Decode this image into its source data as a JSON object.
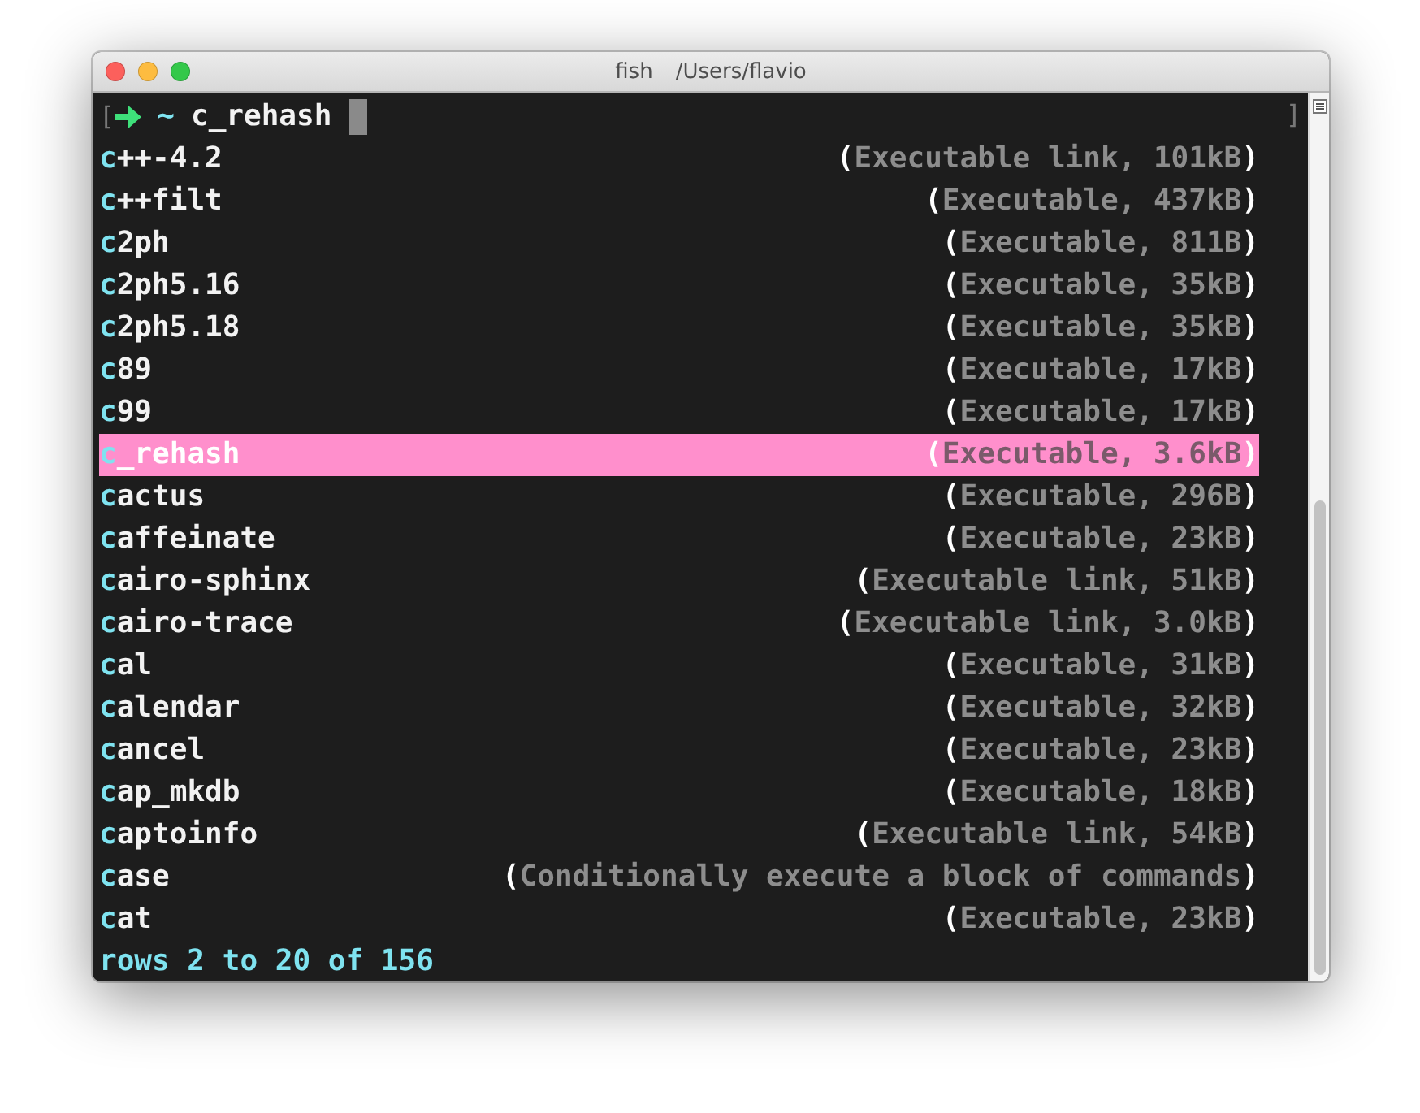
{
  "window": {
    "title": "fish",
    "path": "/Users/flavio"
  },
  "prompt": {
    "open_bracket": "[",
    "directory": "~",
    "command": "c_rehash",
    "close_bracket": "]"
  },
  "completions": [
    {
      "match": "c",
      "rest": "++-4.2",
      "description": "(Executable link, 101kB)",
      "selected": false
    },
    {
      "match": "c",
      "rest": "++filt",
      "description": "(Executable, 437kB)",
      "selected": false
    },
    {
      "match": "c",
      "rest": "2ph",
      "description": "(Executable, 811B)",
      "selected": false
    },
    {
      "match": "c",
      "rest": "2ph5.16",
      "description": "(Executable, 35kB)",
      "selected": false
    },
    {
      "match": "c",
      "rest": "2ph5.18",
      "description": "(Executable, 35kB)",
      "selected": false
    },
    {
      "match": "c",
      "rest": "89",
      "description": "(Executable, 17kB)",
      "selected": false
    },
    {
      "match": "c",
      "rest": "99",
      "description": "(Executable, 17kB)",
      "selected": false
    },
    {
      "match": "c",
      "rest": "_rehash",
      "description": "(Executable, 3.6kB)",
      "selected": true
    },
    {
      "match": "c",
      "rest": "actus",
      "description": "(Executable, 296B)",
      "selected": false
    },
    {
      "match": "c",
      "rest": "affeinate",
      "description": "(Executable, 23kB)",
      "selected": false
    },
    {
      "match": "c",
      "rest": "airo-sphinx",
      "description": "(Executable link, 51kB)",
      "selected": false
    },
    {
      "match": "c",
      "rest": "airo-trace",
      "description": "(Executable link, 3.0kB)",
      "selected": false
    },
    {
      "match": "c",
      "rest": "al",
      "description": "(Executable, 31kB)",
      "selected": false
    },
    {
      "match": "c",
      "rest": "alendar",
      "description": "(Executable, 32kB)",
      "selected": false
    },
    {
      "match": "c",
      "rest": "ancel",
      "description": "(Executable, 23kB)",
      "selected": false
    },
    {
      "match": "c",
      "rest": "ap_mkdb",
      "description": "(Executable, 18kB)",
      "selected": false
    },
    {
      "match": "c",
      "rest": "aptoinfo",
      "description": "(Executable link, 54kB)",
      "selected": false
    },
    {
      "match": "c",
      "rest": "ase",
      "description": "(Conditionally execute a block of commands)",
      "selected": false
    },
    {
      "match": "c",
      "rest": "at",
      "description": "(Executable, 23kB)",
      "selected": false
    }
  ],
  "status": "rows 2 to 20 of 156"
}
